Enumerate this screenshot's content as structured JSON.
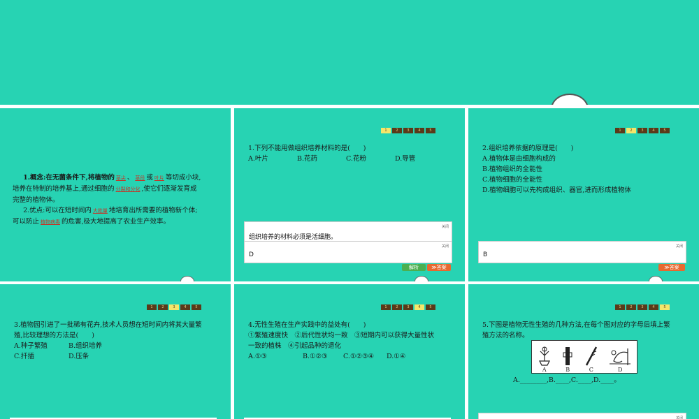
{
  "slide1": {
    "p1_a": "1.概念:在无菌条件下,将植物的",
    "blank_stem_tip": "茎尖",
    "sep1": "、",
    "blank_stem": "茎段",
    "or": "或",
    "blank_leaf": "叶片",
    "p1_b": "等切成小块,",
    "p1_c": "培养在特制的培养基上,通过细胞的",
    "blank_division": "分裂和分化",
    "p1_d": ",使它们逐渐发育成",
    "p1_e": "完整的植物体。",
    "p2_a": "2.优点:可以在短时间内",
    "blank_mass": "大批量",
    "p2_b": "地培育出所需要的植物新个体;",
    "p2_c": "可以防止",
    "blank_disease": "植物病毒",
    "p2_d": "的危害,极大地提高了农业生产效率。"
  },
  "pager": [
    "1",
    "2",
    "3",
    "4",
    "5"
  ],
  "slide2": {
    "question": "1.下列不能用做组织培养材料的是(　　)",
    "options": [
      "A.叶片",
      "B.花药",
      "C.花粉",
      "D.导管"
    ],
    "close1": "关闭",
    "explanation": "组织培养的材料必须是活细胞。",
    "close2": "关闭",
    "answer": "D",
    "btn_explain": "解析",
    "btn_answer": "≫答案"
  },
  "slide3": {
    "question": "2.组织培养依据的原理是(　　)",
    "options": [
      "A.植物体是由细胞构成的",
      "B.植物组织的全能性",
      "C.植物细胞的全能性",
      "D.植物细胞可以先构成组织、器官,进而形成植物体"
    ],
    "close": "关闭",
    "answer": "B",
    "btn_answer": "≫答案"
  },
  "slide4": {
    "question_l1": "3.植物园引进了一批稀有花卉,技术人员想在短时间内将其大量繁",
    "question_l2": "殖,比较理想的方法是(　　)",
    "options": [
      "A.种子繁殖",
      "B.组织培养",
      "C.扦插",
      "D.压条"
    ]
  },
  "slide5": {
    "question": "4.无性生殖在生产实践中的益处有(　　)",
    "stmt_l1": "①繁殖速度快　②后代性状均一致　③短期内可以获得大量性状",
    "stmt_l2": "一致的植株　④引起品种的退化",
    "options": [
      "A.①③",
      "B.①②③",
      "C.①②③④",
      "D.①④"
    ]
  },
  "slide6": {
    "question_l1": "5.下图是植物无性生殖的几种方法,在每个图对应的字母后填上繁",
    "question_l2": "殖方法的名称。",
    "pic_labels": [
      "A",
      "B",
      "C",
      "D"
    ],
    "fill_line": "A.________,B.____,C.____,D.____。",
    "close": "关闭"
  }
}
